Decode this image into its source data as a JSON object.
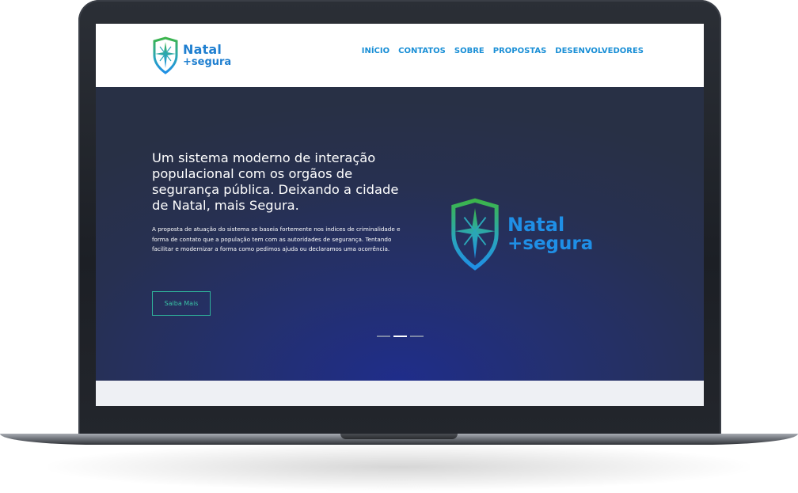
{
  "brand": {
    "name_line1": "Natal",
    "name_line2": "+segura",
    "color_blue": "#1f8fe6",
    "color_green": "#3cb54a",
    "icon": "shield-compass-icon"
  },
  "nav": {
    "items": [
      {
        "label": "INÍCIO"
      },
      {
        "label": "CONTATOS"
      },
      {
        "label": "SOBRE"
      },
      {
        "label": "PROPOSTAS"
      },
      {
        "label": "DESENVOLVEDORES"
      }
    ],
    "link_color": "#1a8fd6"
  },
  "hero": {
    "title": "Um sistema moderno de interação populacional com os orgãos de segurança pública. Deixando a cidade de Natal, mais Segura.",
    "description": "A proposta de atuação do sistema se baseia fortemente nos indices de criminalidade e forma de contato que a população tem com as autoridades de segurança. Tentando facilitar e modernizar a forma como pedimos ajuda ou declaramos uma ocorrência.",
    "button_label": "Saiba Mais",
    "button_color": "#2fb39a",
    "background_color": "#24306e",
    "carousel_total": 3,
    "carousel_active": 2
  }
}
